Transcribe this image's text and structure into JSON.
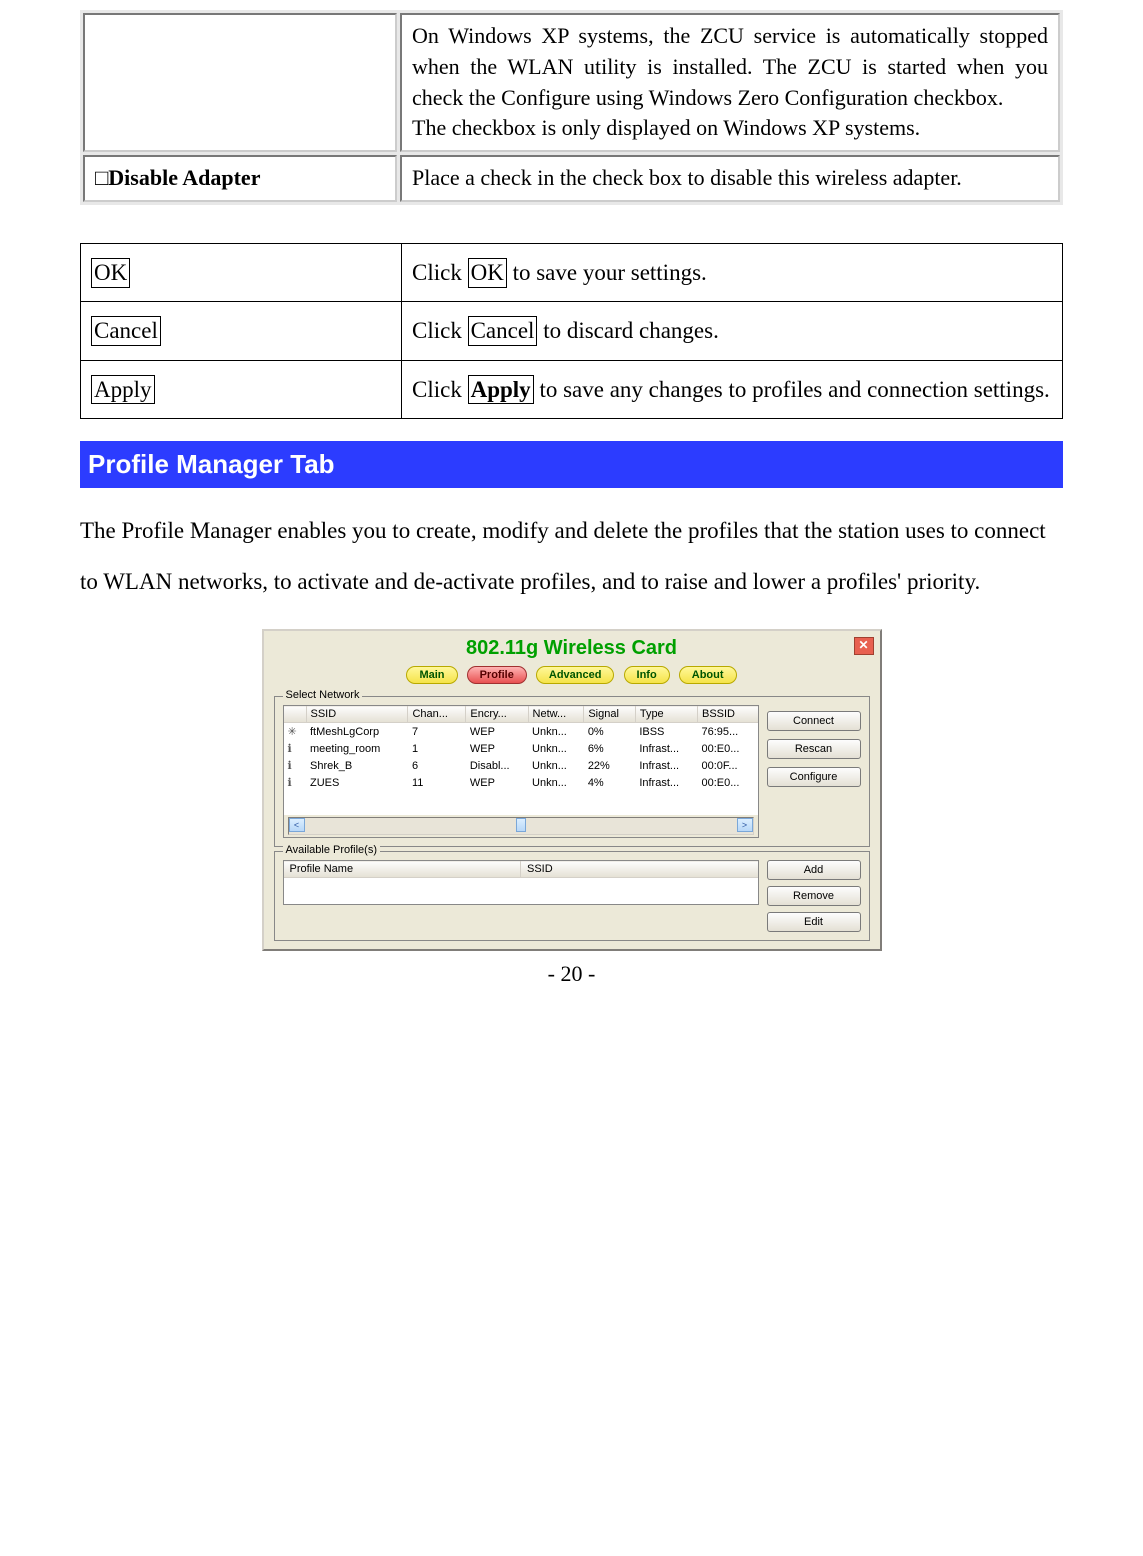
{
  "table1": {
    "row1_right_p1": "On Windows XP systems, the ZCU service is automatically stopped when the WLAN utility is installed. The ZCU is started when you check the Configure using Windows Zero Configuration checkbox.",
    "row1_right_p2": "The checkbox is only displayed on Windows XP systems.",
    "row2_left": "□Disable Adapter",
    "row2_right": "Place a check in the check box to disable this wireless adapter."
  },
  "table2": {
    "r1_left": "OK",
    "r1_right_a": "Click ",
    "r1_right_box": "OK",
    "r1_right_b": " to save your settings.",
    "r2_left": "Cancel",
    "r2_right_a": "Click ",
    "r2_right_box": "Cancel",
    "r2_right_b": " to discard changes.",
    "r3_left": "Apply",
    "r3_right_a": "Click ",
    "r3_right_box": "Apply",
    "r3_right_b": " to save any changes to profiles and connection settings."
  },
  "section_heading": "Profile Manager Tab",
  "body_paragraph": "The Profile Manager enables you to create, modify and delete the profiles that the station uses to connect to WLAN networks, to activate and de-activate profiles, and to raise and lower a profiles' priority.",
  "screenshot": {
    "title": "802.11g Wireless Card",
    "tabs": [
      "Main",
      "Profile",
      "Advanced",
      "Info",
      "About"
    ],
    "active_tab_index": 1,
    "select_network_label": "Select Network",
    "columns": [
      "SSID",
      "Chan...",
      "Encry...",
      "Netw...",
      "Signal",
      "Type",
      "BSSID"
    ],
    "rows": [
      {
        "icon": "✳",
        "ssid": "ftMeshLgCorp",
        "chan": "7",
        "encry": "WEP",
        "netw": "Unkn...",
        "signal": "0%",
        "type": "IBSS",
        "bssid": "76:95..."
      },
      {
        "icon": "ℹ",
        "ssid": "meeting_room",
        "chan": "1",
        "encry": "WEP",
        "netw": "Unkn...",
        "signal": "6%",
        "type": "Infrast...",
        "bssid": "00:E0..."
      },
      {
        "icon": "ℹ",
        "ssid": "Shrek_B",
        "chan": "6",
        "encry": "Disabl...",
        "netw": "Unkn...",
        "signal": "22%",
        "type": "Infrast...",
        "bssid": "00:0F..."
      },
      {
        "icon": "ℹ",
        "ssid": "ZUES",
        "chan": "11",
        "encry": "WEP",
        "netw": "Unkn...",
        "signal": "4%",
        "type": "Infrast...",
        "bssid": "00:E0..."
      }
    ],
    "right_buttons_top": [
      "Connect",
      "Rescan",
      "Configure"
    ],
    "available_profiles_label": "Available Profile(s)",
    "profile_columns": [
      "Profile Name",
      "SSID"
    ],
    "right_buttons_bottom": [
      "Add",
      "Remove",
      "Edit"
    ]
  },
  "page_number": "- 20 -"
}
